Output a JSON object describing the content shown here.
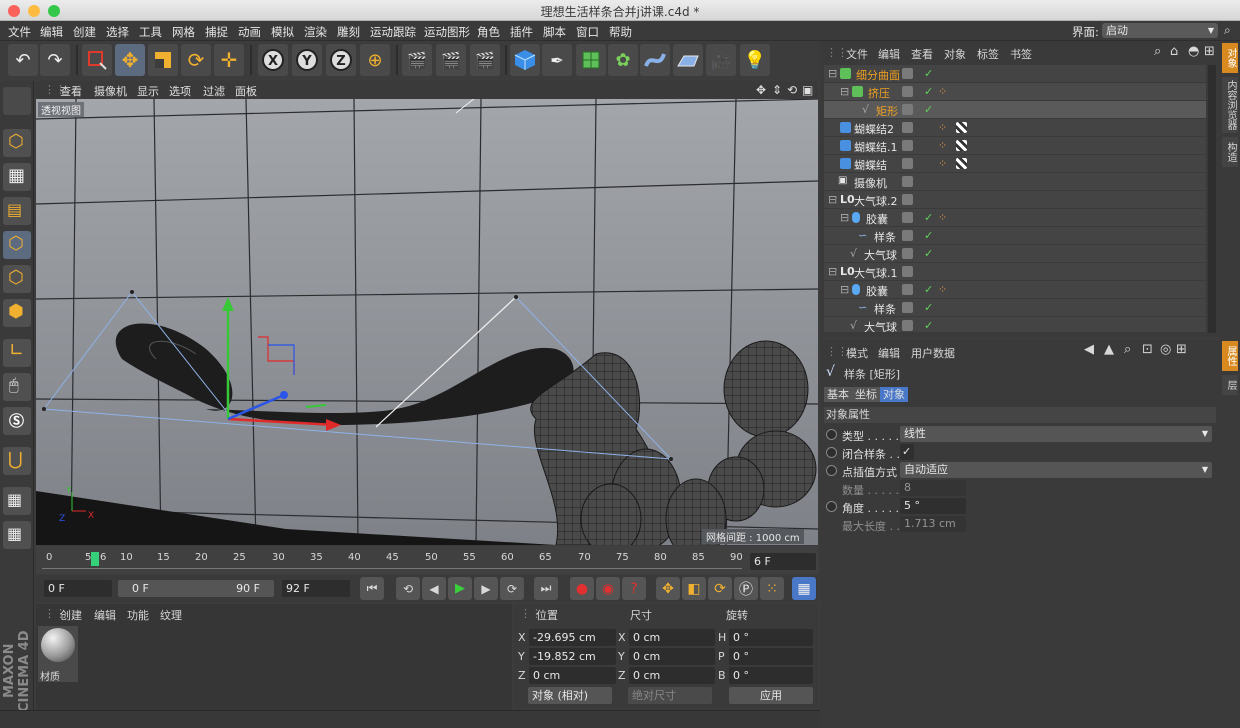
{
  "window": {
    "title": "理想生活样条合并j讲课.c4d *"
  },
  "menubar": {
    "items": [
      "文件",
      "编辑",
      "创建",
      "选择",
      "工具",
      "网格",
      "捕捉",
      "动画",
      "模拟",
      "渲染",
      "雕刻",
      "运动跟踪",
      "运动图形",
      "角色",
      "插件",
      "脚本",
      "窗口",
      "帮助"
    ],
    "interface_label": "界面:",
    "interface_value": "启动"
  },
  "viewport": {
    "menu": [
      "查看",
      "摄像机",
      "显示",
      "选项",
      "过滤",
      "面板"
    ],
    "view_name": "透视视图",
    "grid_spacing": "网格间距 : 1000 cm"
  },
  "timeline": {
    "ticks": [
      "0",
      "5",
      "6",
      "10",
      "15",
      "20",
      "25",
      "30",
      "35",
      "40",
      "45",
      "50",
      "55",
      "60",
      "65",
      "70",
      "75",
      "80",
      "85",
      "90"
    ],
    "current_frame_field": "6 F"
  },
  "tl_controls": {
    "start": "0 F",
    "range_start": "0 F",
    "range_end": "90 F",
    "end": "92 F"
  },
  "material_manager": {
    "menu": [
      "创建",
      "编辑",
      "功能",
      "纹理"
    ],
    "material_name": "材质"
  },
  "coords": {
    "headers": [
      "位置",
      "尺寸",
      "旋转"
    ],
    "rows": [
      {
        "a": "X",
        "pos": "-29.695 cm",
        "b": "X",
        "size": "0 cm",
        "c": "H",
        "rot": "0 °"
      },
      {
        "a": "Y",
        "pos": "-19.852 cm",
        "b": "Y",
        "size": "0 cm",
        "c": "P",
        "rot": "0 °"
      },
      {
        "a": "Z",
        "pos": "0 cm",
        "b": "Z",
        "size": "0 cm",
        "c": "B",
        "rot": "0 °"
      }
    ],
    "mode": "对象 (相对)",
    "size_mode": "绝对尺寸",
    "apply": "应用"
  },
  "object_manager": {
    "menu": [
      "文件",
      "编辑",
      "查看",
      "对象",
      "标签",
      "书签"
    ],
    "objects": [
      {
        "name": "细分曲面",
        "color": "#f0a020"
      },
      {
        "name": "挤压",
        "color": "#f0a020"
      },
      {
        "name": "矩形",
        "color": "#f0a020"
      },
      {
        "name": "蝴蝶结2",
        "color": "#e6e6e6"
      },
      {
        "name": "蝴蝶结.1",
        "color": "#e6e6e6"
      },
      {
        "name": "蝴蝶结",
        "color": "#e6e6e6"
      },
      {
        "name": "摄像机",
        "color": "#e6e6e6"
      },
      {
        "name": "大气球.2",
        "color": "#e6e6e6"
      },
      {
        "name": "胶囊",
        "color": "#e6e6e6"
      },
      {
        "name": "样条",
        "color": "#e6e6e6"
      },
      {
        "name": "大气球",
        "color": "#e6e6e6"
      },
      {
        "name": "大气球.1",
        "color": "#e6e6e6"
      },
      {
        "name": "胶囊",
        "color": "#e6e6e6"
      },
      {
        "name": "样条",
        "color": "#e6e6e6"
      },
      {
        "name": "大气球",
        "color": "#e6e6e6"
      }
    ]
  },
  "attr_manager": {
    "menu": [
      "模式",
      "编辑",
      "用户数据"
    ],
    "object_title": "样条 [矩形]",
    "tabs": [
      "基本",
      "坐标",
      "对象"
    ],
    "section": "对象属性",
    "props": [
      {
        "label": "类型 . . . . .",
        "value": "线性"
      },
      {
        "label": "闭合样条 . .",
        "value": "✓"
      },
      {
        "label": "点插值方式",
        "value": "自动适应"
      },
      {
        "label": "数量 . . . . .",
        "value": "8"
      },
      {
        "label": "角度 . . . . .",
        "value": "5 °"
      },
      {
        "label": "最大长度 . .",
        "value": "1.713 cm"
      }
    ]
  },
  "right_tabs": [
    "对象",
    "内容浏览器",
    "构造",
    "属性",
    "层"
  ],
  "branding": "MAXON CINEMA 4D"
}
